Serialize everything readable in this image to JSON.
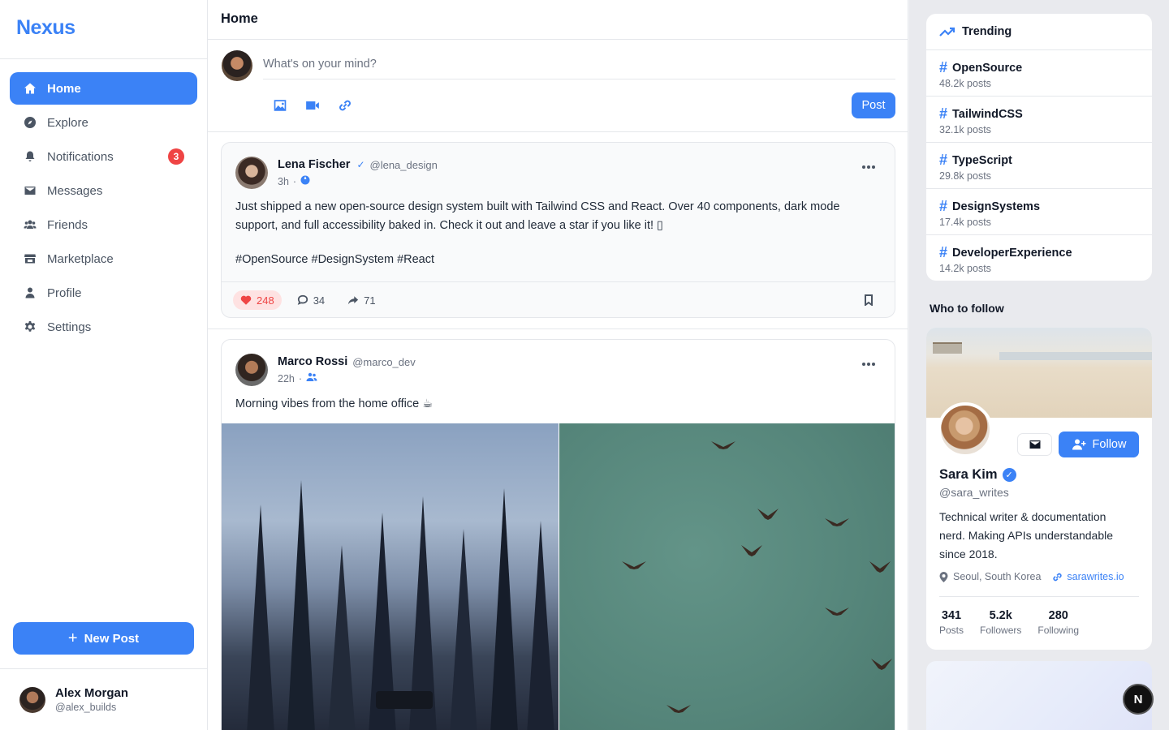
{
  "app": {
    "logo": "Nexus"
  },
  "sidebar": {
    "items": [
      {
        "label": "Home",
        "icon": "home-icon",
        "active": true
      },
      {
        "label": "Explore",
        "icon": "compass-icon"
      },
      {
        "label": "Notifications",
        "icon": "bell-icon",
        "badge": "3"
      },
      {
        "label": "Messages",
        "icon": "envelope-icon"
      },
      {
        "label": "Friends",
        "icon": "users-icon"
      },
      {
        "label": "Marketplace",
        "icon": "store-icon"
      },
      {
        "label": "Profile",
        "icon": "user-icon"
      },
      {
        "label": "Settings",
        "icon": "gear-icon"
      }
    ],
    "new_post_label": "New Post",
    "user": {
      "name": "Alex Morgan",
      "handle": "@alex_builds"
    }
  },
  "main": {
    "title": "Home",
    "composer": {
      "placeholder": "What's on your mind?",
      "post_label": "Post"
    },
    "posts": [
      {
        "author": "Lena Fischer",
        "verified": "✓",
        "handle": "@lena_design",
        "time": "3h",
        "visibility_icon": "globe-icon",
        "text": "Just shipped a new open-source design system built with Tailwind CSS and React. Over 40 components, dark mode support, and full accessibility baked in. Check it out and leave a star if you like it! ▯",
        "tags": "#OpenSource #DesignSystem #React",
        "likes": "248",
        "comments": "34",
        "shares": "71"
      },
      {
        "author": "Marco Rossi",
        "handle": "@marco_dev",
        "time": "22h",
        "visibility_icon": "friends-icon",
        "text": "Morning vibes from the home office ☕"
      }
    ]
  },
  "right": {
    "trending_title": "Trending",
    "trending": [
      {
        "tag": "OpenSource",
        "count": "48.2k posts"
      },
      {
        "tag": "TailwindCSS",
        "count": "32.1k posts"
      },
      {
        "tag": "TypeScript",
        "count": "29.8k posts"
      },
      {
        "tag": "DesignSystems",
        "count": "17.4k posts"
      },
      {
        "tag": "DeveloperExperience",
        "count": "14.2k posts"
      }
    ],
    "who_to_follow_title": "Who to follow",
    "profile": {
      "name": "Sara Kim",
      "handle": "@sara_writes",
      "bio": "Technical writer & documentation nerd. Making APIs understandable since 2018.",
      "location": "Seoul, South Korea",
      "website": "sarawrites.io",
      "follow_label": "Follow",
      "stats": [
        {
          "value": "341",
          "label": "Posts"
        },
        {
          "value": "5.2k",
          "label": "Followers"
        },
        {
          "value": "280",
          "label": "Following"
        }
      ]
    },
    "fab_label": "N"
  },
  "colors": {
    "accent": "#3b82f6",
    "badge": "#ef4444",
    "like": "#ef4444"
  }
}
